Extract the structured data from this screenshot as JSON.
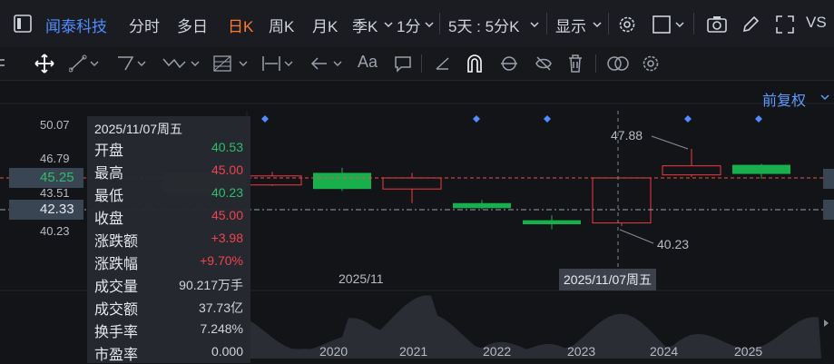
{
  "toolbar": {
    "stock_name": "闻泰科技",
    "period_fenshi": "分时",
    "period_duori": "多日",
    "period_rik": "日K",
    "period_zhouk": "周K",
    "period_yuek": "月K",
    "period_jik": "季K",
    "period_1fen": "1分",
    "period_5day": "5天 : 5分K",
    "display": "显示",
    "vs": "VS"
  },
  "chart_header": {
    "adjust_label": "前复权"
  },
  "y_axis": {
    "ticks": [
      "50.07",
      "46.79",
      "43.51",
      "40.23"
    ],
    "current_price": "45.25",
    "crosshair_price": "42.33"
  },
  "annotations": {
    "high": "47.88",
    "low": "40.23"
  },
  "time_axis": {
    "month_label": "2025/11",
    "crosshair_date": "2025/11/07周五",
    "years": [
      "2020",
      "2021",
      "2022",
      "2023",
      "2024",
      "2025"
    ]
  },
  "info_panel": {
    "date": "2025/11/07周五",
    "rows": [
      {
        "label": "开盘",
        "value": "40.53",
        "color": "#2ebd6b"
      },
      {
        "label": "最高",
        "value": "45.00",
        "color": "#f0434e"
      },
      {
        "label": "最低",
        "value": "40.23",
        "color": "#2ebd6b"
      },
      {
        "label": "收盘",
        "value": "45.00",
        "color": "#f0434e"
      },
      {
        "label": "涨跌额",
        "value": "+3.98",
        "color": "#f0434e"
      },
      {
        "label": "涨跌幅",
        "value": "+9.70%",
        "color": "#f0434e"
      },
      {
        "label": "成交量",
        "value": "90.217万手",
        "color": "#cfd3dc"
      },
      {
        "label": "成交额",
        "value": "37.73亿",
        "color": "#cfd3dc"
      },
      {
        "label": "换手率",
        "value": "7.248%",
        "color": "#cfd3dc"
      },
      {
        "label": "市盈率",
        "value": "0.000",
        "color": "#cfd3dc"
      }
    ]
  },
  "candles": [
    {
      "open": 44.3,
      "close": 45.2,
      "high": 45.6,
      "low": 44.2,
      "up": true
    },
    {
      "open": 45.5,
      "close": 43.9,
      "high": 46.0,
      "low": 43.7,
      "up": false
    },
    {
      "open": 43.9,
      "close": 45.0,
      "high": 45.5,
      "low": 42.5,
      "up": true
    },
    {
      "open": 42.5,
      "close": 42.0,
      "high": 42.8,
      "low": 41.9,
      "up": false
    },
    {
      "open": 40.8,
      "close": 40.4,
      "high": 41.3,
      "low": 39.9,
      "up": false
    },
    {
      "open": 40.53,
      "close": 45.0,
      "high": 45.0,
      "low": 40.23,
      "up": true
    },
    {
      "open": 45.3,
      "close": 46.2,
      "high": 47.88,
      "low": 45.1,
      "up": true
    },
    {
      "open": 46.3,
      "close": 45.4,
      "high": 46.4,
      "low": 44.9,
      "up": false
    }
  ],
  "colors": {
    "up": "#ef3a44",
    "down": "#18b04d",
    "accent": "#4f8cff",
    "active": "#ff7a2e"
  }
}
